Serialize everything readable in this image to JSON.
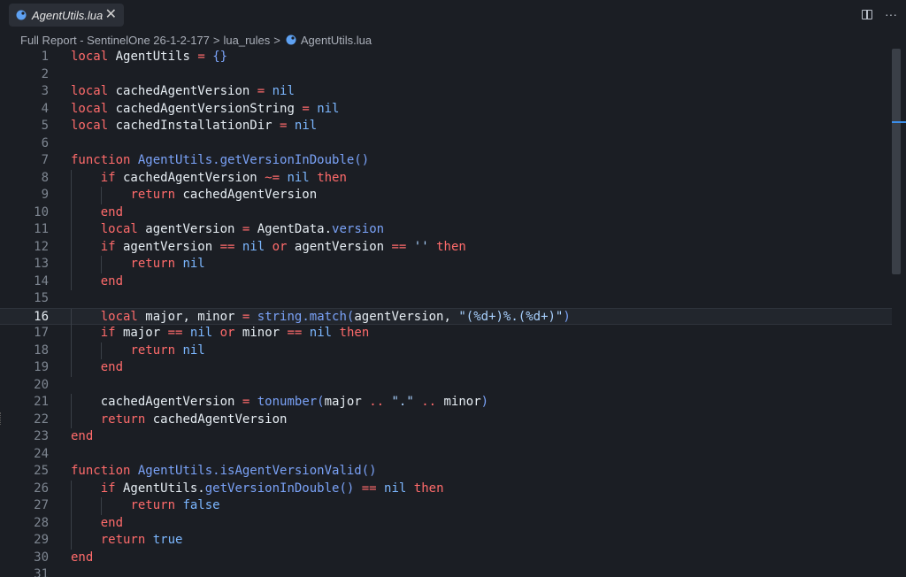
{
  "tab": {
    "title": "AgentUtils.lua",
    "close_glyph": "✕"
  },
  "top_actions": {
    "split_label": "",
    "more_glyph": "···"
  },
  "breadcrumb": {
    "items": [
      "Full Report - SentinelOne 26-1-2-177",
      "lua_rules",
      "AgentUtils.lua"
    ],
    "separator": ">"
  },
  "editor": {
    "current_line": 16,
    "lines": [
      {
        "n": "1",
        "indent": 0,
        "t": [
          [
            "k",
            "local"
          ],
          [
            "v",
            " AgentUtils "
          ],
          [
            "o",
            "="
          ],
          [
            "v",
            " "
          ],
          [
            "f",
            "{}"
          ]
        ]
      },
      {
        "n": "2",
        "indent": 0,
        "t": []
      },
      {
        "n": "3",
        "indent": 0,
        "t": [
          [
            "k",
            "local"
          ],
          [
            "v",
            " cachedAgentVersion "
          ],
          [
            "o",
            "="
          ],
          [
            "v",
            " "
          ],
          [
            "n",
            "nil"
          ]
        ]
      },
      {
        "n": "4",
        "indent": 0,
        "t": [
          [
            "k",
            "local"
          ],
          [
            "v",
            " cachedAgentVersionString "
          ],
          [
            "o",
            "="
          ],
          [
            "v",
            " "
          ],
          [
            "n",
            "nil"
          ]
        ]
      },
      {
        "n": "5",
        "indent": 0,
        "t": [
          [
            "k",
            "local"
          ],
          [
            "v",
            " cachedInstallationDir "
          ],
          [
            "o",
            "="
          ],
          [
            "v",
            " "
          ],
          [
            "n",
            "nil"
          ]
        ]
      },
      {
        "n": "6",
        "indent": 0,
        "t": []
      },
      {
        "n": "7",
        "indent": 0,
        "t": [
          [
            "k",
            "function"
          ],
          [
            "v",
            " "
          ],
          [
            "f",
            "AgentUtils.getVersionInDouble()"
          ]
        ]
      },
      {
        "n": "8",
        "indent": 1,
        "t": [
          [
            "k",
            "if"
          ],
          [
            "v",
            " cachedAgentVersion "
          ],
          [
            "o",
            "~="
          ],
          [
            "v",
            " "
          ],
          [
            "n",
            "nil"
          ],
          [
            "v",
            " "
          ],
          [
            "k",
            "then"
          ]
        ]
      },
      {
        "n": "9",
        "indent": 2,
        "t": [
          [
            "k",
            "return"
          ],
          [
            "v",
            " cachedAgentVersion"
          ]
        ]
      },
      {
        "n": "10",
        "indent": 1,
        "t": [
          [
            "k",
            "end"
          ]
        ]
      },
      {
        "n": "11",
        "indent": 1,
        "t": [
          [
            "k",
            "local"
          ],
          [
            "v",
            " agentVersion "
          ],
          [
            "o",
            "="
          ],
          [
            "v",
            " AgentData."
          ],
          [
            "f",
            "version"
          ]
        ]
      },
      {
        "n": "12",
        "indent": 1,
        "t": [
          [
            "k",
            "if"
          ],
          [
            "v",
            " agentVersion "
          ],
          [
            "o",
            "=="
          ],
          [
            "v",
            " "
          ],
          [
            "n",
            "nil"
          ],
          [
            "v",
            " "
          ],
          [
            "k",
            "or"
          ],
          [
            "v",
            " agentVersion "
          ],
          [
            "o",
            "=="
          ],
          [
            "v",
            " "
          ],
          [
            "s",
            "''"
          ],
          [
            "v",
            " "
          ],
          [
            "k",
            "then"
          ]
        ]
      },
      {
        "n": "13",
        "indent": 2,
        "t": [
          [
            "k",
            "return"
          ],
          [
            "v",
            " "
          ],
          [
            "n",
            "nil"
          ]
        ]
      },
      {
        "n": "14",
        "indent": 1,
        "t": [
          [
            "k",
            "end"
          ]
        ]
      },
      {
        "n": "15",
        "indent": 0,
        "t": []
      },
      {
        "n": "16",
        "indent": 1,
        "t": [
          [
            "k",
            "local"
          ],
          [
            "v",
            " major, minor "
          ],
          [
            "o",
            "="
          ],
          [
            "v",
            " "
          ],
          [
            "f",
            "string.match("
          ],
          [
            "v",
            "agentVersion, "
          ],
          [
            "s",
            "\"(%d+)%.(%d+)\""
          ],
          [
            "f",
            ")"
          ]
        ]
      },
      {
        "n": "17",
        "indent": 1,
        "t": [
          [
            "k",
            "if"
          ],
          [
            "v",
            " major "
          ],
          [
            "o",
            "=="
          ],
          [
            "v",
            " "
          ],
          [
            "n",
            "nil"
          ],
          [
            "v",
            " "
          ],
          [
            "k",
            "or"
          ],
          [
            "v",
            " minor "
          ],
          [
            "o",
            "=="
          ],
          [
            "v",
            " "
          ],
          [
            "n",
            "nil"
          ],
          [
            "v",
            " "
          ],
          [
            "k",
            "then"
          ]
        ]
      },
      {
        "n": "18",
        "indent": 2,
        "t": [
          [
            "k",
            "return"
          ],
          [
            "v",
            " "
          ],
          [
            "n",
            "nil"
          ]
        ]
      },
      {
        "n": "19",
        "indent": 1,
        "t": [
          [
            "k",
            "end"
          ]
        ]
      },
      {
        "n": "20",
        "indent": 0,
        "t": []
      },
      {
        "n": "21",
        "indent": 1,
        "t": [
          [
            "v",
            "cachedAgentVersion "
          ],
          [
            "o",
            "="
          ],
          [
            "v",
            " "
          ],
          [
            "f",
            "tonumber("
          ],
          [
            "v",
            "major "
          ],
          [
            "o",
            ".."
          ],
          [
            "v",
            " "
          ],
          [
            "s",
            "\".\""
          ],
          [
            "v",
            " "
          ],
          [
            "o",
            ".."
          ],
          [
            "v",
            " minor"
          ],
          [
            "f",
            ")"
          ]
        ]
      },
      {
        "n": "22",
        "indent": 1,
        "t": [
          [
            "k",
            "return"
          ],
          [
            "v",
            " cachedAgentVersion"
          ]
        ]
      },
      {
        "n": "23",
        "indent": 0,
        "t": [
          [
            "k",
            "end"
          ]
        ]
      },
      {
        "n": "24",
        "indent": 0,
        "t": []
      },
      {
        "n": "25",
        "indent": 0,
        "t": [
          [
            "k",
            "function"
          ],
          [
            "v",
            " "
          ],
          [
            "f",
            "AgentUtils.isAgentVersionValid()"
          ]
        ]
      },
      {
        "n": "26",
        "indent": 1,
        "t": [
          [
            "k",
            "if"
          ],
          [
            "v",
            " AgentUtils."
          ],
          [
            "f",
            "getVersionInDouble()"
          ],
          [
            "v",
            " "
          ],
          [
            "o",
            "=="
          ],
          [
            "v",
            " "
          ],
          [
            "n",
            "nil"
          ],
          [
            "v",
            " "
          ],
          [
            "k",
            "then"
          ]
        ]
      },
      {
        "n": "27",
        "indent": 2,
        "t": [
          [
            "k",
            "return"
          ],
          [
            "v",
            " "
          ],
          [
            "n",
            "false"
          ]
        ]
      },
      {
        "n": "28",
        "indent": 1,
        "t": [
          [
            "k",
            "end"
          ]
        ]
      },
      {
        "n": "29",
        "indent": 1,
        "t": [
          [
            "k",
            "return"
          ],
          [
            "v",
            " "
          ],
          [
            "n",
            "true"
          ]
        ]
      },
      {
        "n": "30",
        "indent": 0,
        "t": [
          [
            "k",
            "end"
          ]
        ]
      },
      {
        "n": "31",
        "indent": 0,
        "t": []
      }
    ]
  },
  "colors": {
    "background": "#1b1e24",
    "keyword": "#ff6b6b",
    "function": "#7aa2f7",
    "constant": "#7cb7ff",
    "string": "#a9d1ff"
  }
}
